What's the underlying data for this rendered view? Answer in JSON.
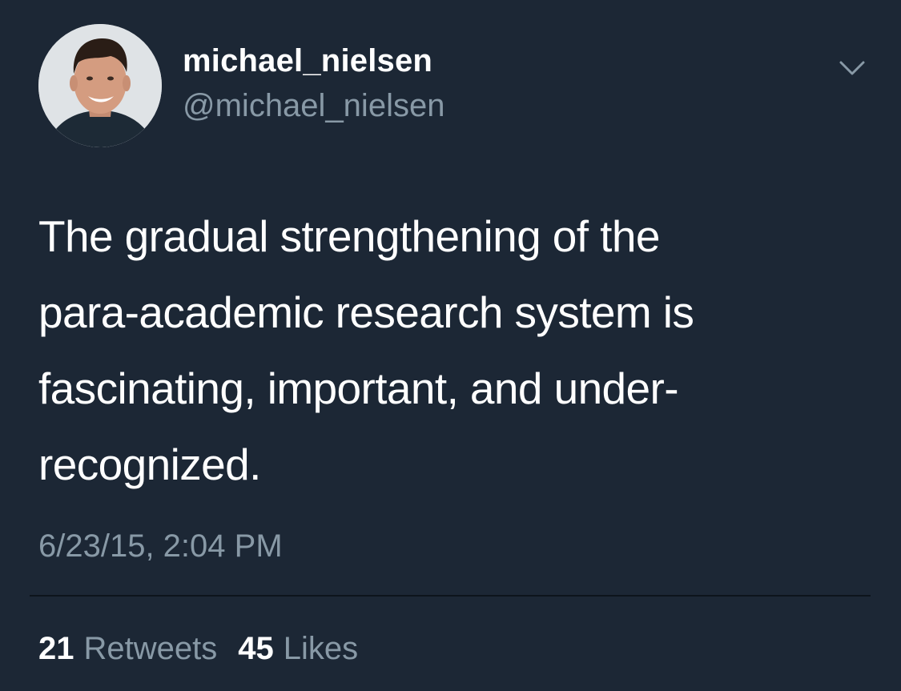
{
  "tweet": {
    "display_name": "michael_nielsen",
    "handle": "@michael_nielsen",
    "avatar_icon": "profile-photo",
    "menu_icon": "chevron-down-icon",
    "text": "The gradual strengthening of the\npara-academic research system is\nfascinating, important, and under-\nrecognized.",
    "timestamp": "6/23/15, 2:04 PM",
    "stats": {
      "retweets_count": "21",
      "retweets_label": "Retweets",
      "likes_count": "45",
      "likes_label": "Likes"
    }
  },
  "colors": {
    "background": "#1c2735",
    "text_primary": "#ffffff",
    "text_secondary": "#8899a6",
    "divider": "#0d141c"
  }
}
